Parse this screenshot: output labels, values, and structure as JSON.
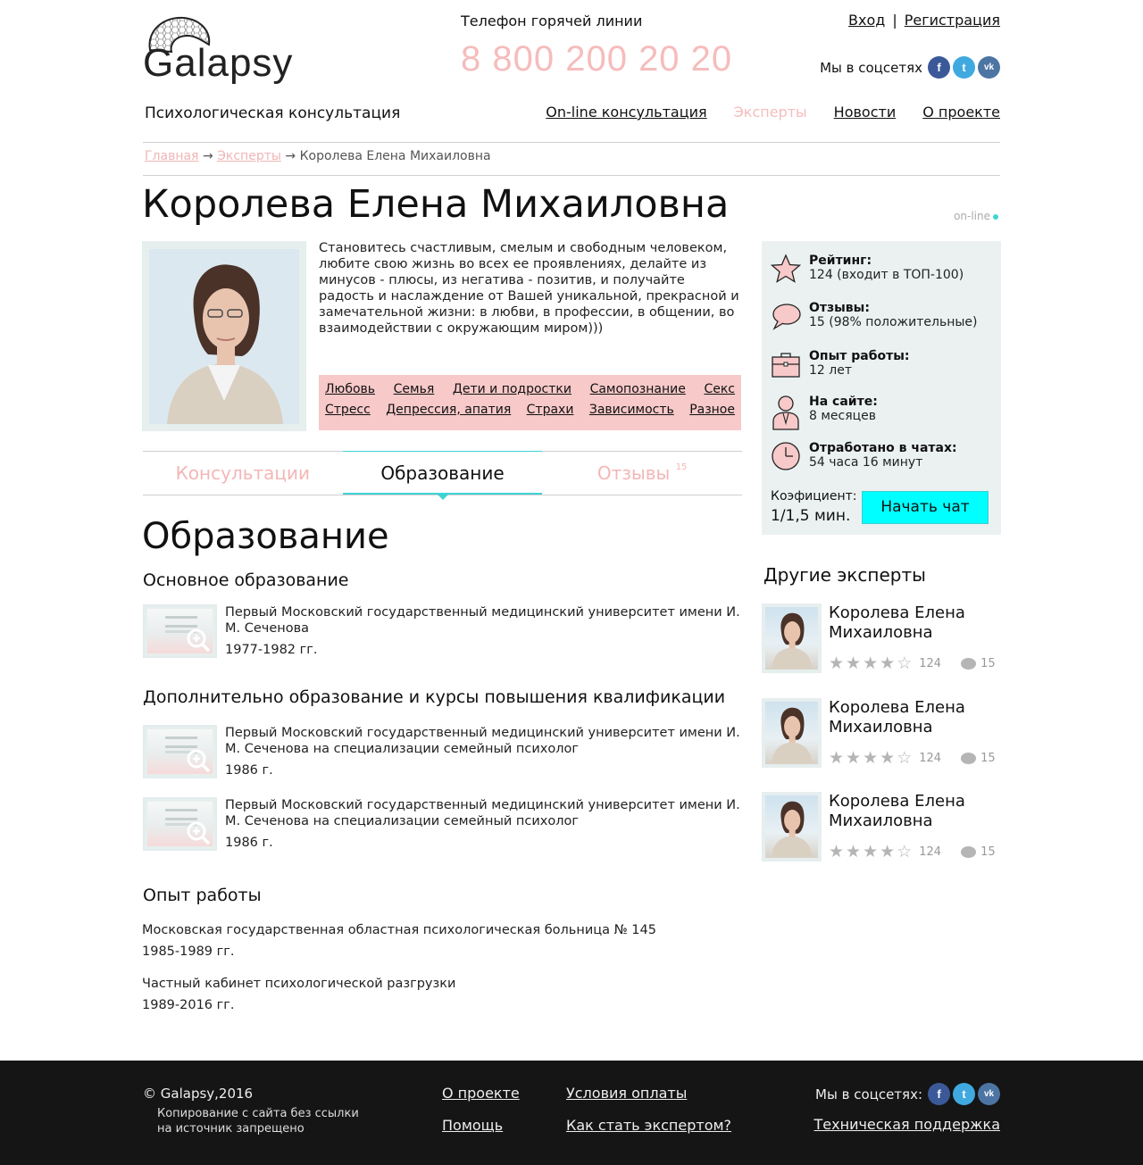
{
  "header": {
    "logo_text": "Galapsy",
    "tagline": "Психологическая консультация",
    "hotline_label": "Телефон горячей линии",
    "hotline_number": "8 800 200 20 20",
    "login": "Вход",
    "auth_separator": "|",
    "register": "Регистрация",
    "social_label": "Мы в соцсетях",
    "nav": [
      "On-line консультация",
      "Эксперты",
      "Новости",
      "О проекте"
    ]
  },
  "breadcrumb": {
    "home": "Главная",
    "experts": "Эксперты",
    "arrow": "→",
    "current": "Королева Елена Михаиловна"
  },
  "expert": {
    "name": "Королева Елена Михаиловна",
    "status": "on-line",
    "bio": "Становитесь счастливым, смелым и свободным человеком, любите свою жизнь во всех ее проявлениях, делайте из минусов - плюсы, из негатива - позитив, и получайте радость и наслаждение от Вашей уникальной, прекрасной и замечательной жизни: в любви, в профессии, в общении, во взаимодействии с окружающим миром)))",
    "tags_row1": [
      "Любовь",
      "Семья",
      "Дети и подростки",
      "Самопознание",
      "Секс"
    ],
    "tags_row2": [
      "Стресс",
      "Депрессия, апатия",
      "Страхи",
      "Зависимость",
      "Разное"
    ]
  },
  "tabs": {
    "consult": "Консультации",
    "education": "Образование",
    "reviews": "Отзывы",
    "reviews_count": "15"
  },
  "education": {
    "title": "Образование",
    "main_title": "Основное образование",
    "main": [
      {
        "text": "Первый Московский государственный медицинский университет имени И. М. Сеченова",
        "year": "1977-1982 гг."
      }
    ],
    "extra_title": "Дополнительно образование и курсы повышения квалификации",
    "extra": [
      {
        "text": "Первый Московский государственный медицинский университет имени И. М. Сеченова на специализации семейный психолог",
        "year": "1986 г."
      },
      {
        "text": "Первый Московский государственный медицинский университет имени И. М. Сеченова на специализации семейный психолог",
        "year": "1986 г."
      }
    ],
    "work_title": "Опыт работы",
    "work": [
      {
        "place": "Московская государственная областная психологическая больница № 145",
        "years": "1985-1989 гг."
      },
      {
        "place": "Частный кабинет психологической разгрузки",
        "years": "1989-2016 гг."
      }
    ]
  },
  "stats": {
    "rating_label": "Рейтинг:",
    "rating_value": "124 (входит в ТОП-100)",
    "reviews_label": "Отзывы:",
    "reviews_value": "15 (98% положительные)",
    "experience_label": "Опыт работы:",
    "experience_value": "12 лет",
    "onsite_label": "На сайте:",
    "onsite_value": "8 месяцев",
    "chat_label": "Отработано в чатах:",
    "chat_value": "54 часа 16 минут",
    "coef_label": "Коэфициент:",
    "coef_value": "1/1,5 мин.",
    "start_chat": "Начать чат"
  },
  "others": {
    "title": "Другие эксперты",
    "items": [
      {
        "name_line1": "Королева Елена",
        "name_line2": "Михаиловна",
        "stars": 4,
        "rating": "124",
        "reviews": "15"
      },
      {
        "name_line1": "Королева Елена",
        "name_line2": "Михаиловна",
        "stars": 4,
        "rating": "124",
        "reviews": "15"
      },
      {
        "name_line1": "Королева Елена",
        "name_line2": "Михаиловна",
        "stars": 4,
        "rating": "124",
        "reviews": "15"
      }
    ]
  },
  "footer": {
    "copyright": "© Galapsy,2016",
    "note": "Копирование с сайта без ссылки на источник запрещено",
    "about": "О проекте",
    "help": "Помощь",
    "payment": "Условия оплаты",
    "become_expert": "Как стать экспертом?",
    "social_label": "Мы в соцсетях:",
    "support": "Техническая поддержка"
  },
  "colors": {
    "accent_pink": "#f6bcbc",
    "accent_cyan": "#00ffff",
    "tags_bg": "#f8c9c9",
    "stats_bg": "#ebf1f1",
    "footer_bg": "#151515"
  },
  "icons": {
    "facebook": "f",
    "twitter": "t",
    "vk": "vk"
  }
}
